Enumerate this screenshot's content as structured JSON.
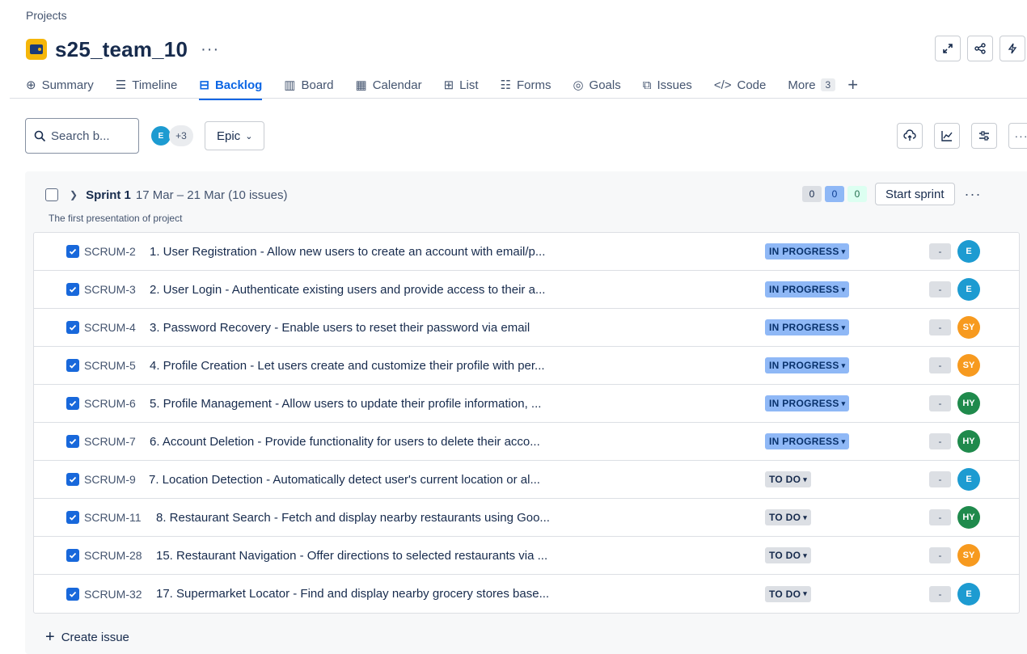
{
  "breadcrumb": "Projects",
  "project": {
    "name": "s25_team_10",
    "more": "···"
  },
  "tabs": [
    {
      "label": "Summary",
      "icon": "globe-icon",
      "glyph": "⊕",
      "active": false
    },
    {
      "label": "Timeline",
      "icon": "timeline-icon",
      "glyph": "☰",
      "active": false
    },
    {
      "label": "Backlog",
      "icon": "backlog-icon",
      "glyph": "⊟",
      "active": true
    },
    {
      "label": "Board",
      "icon": "board-icon",
      "glyph": "▥",
      "active": false
    },
    {
      "label": "Calendar",
      "icon": "calendar-icon",
      "glyph": "▦",
      "active": false
    },
    {
      "label": "List",
      "icon": "list-icon",
      "glyph": "⊞",
      "active": false
    },
    {
      "label": "Forms",
      "icon": "forms-icon",
      "glyph": "☷",
      "active": false
    },
    {
      "label": "Goals",
      "icon": "goals-icon",
      "glyph": "◎",
      "active": false
    },
    {
      "label": "Issues",
      "icon": "issues-icon",
      "glyph": "⧉",
      "active": false
    },
    {
      "label": "Code",
      "icon": "code-icon",
      "glyph": "</>",
      "active": false
    },
    {
      "label": "More",
      "icon": "",
      "glyph": "",
      "active": false,
      "count": "3"
    }
  ],
  "toolbar": {
    "search_placeholder": "Search b...",
    "avatar_initial": "E",
    "avatar_extra": "+3",
    "epic_label": "Epic"
  },
  "sprint": {
    "name": "Sprint 1",
    "dates": "17 Mar – 21 Mar (10 issues)",
    "description": "The first presentation of project",
    "counts": [
      "0",
      "0",
      "0"
    ],
    "start_label": "Start sprint",
    "more": "···"
  },
  "issues": [
    {
      "key": "SCRUM-2",
      "summary": "1. User Registration - Allow new users to create an account with email/p...",
      "status": "IN PROGRESS",
      "estimate": "-",
      "assignee": "E",
      "assignee_color": "#1d9bd1"
    },
    {
      "key": "SCRUM-3",
      "summary": "2. User Login - Authenticate existing users and provide access to their a...",
      "status": "IN PROGRESS",
      "estimate": "-",
      "assignee": "E",
      "assignee_color": "#1d9bd1"
    },
    {
      "key": "SCRUM-4",
      "summary": "3. Password Recovery - Enable users to reset their password via email",
      "status": "IN PROGRESS",
      "estimate": "-",
      "assignee": "SY",
      "assignee_color": "#f79a1f"
    },
    {
      "key": "SCRUM-5",
      "summary": "4. Profile Creation - Let users create and customize their profile with per...",
      "status": "IN PROGRESS",
      "estimate": "-",
      "assignee": "SY",
      "assignee_color": "#f79a1f"
    },
    {
      "key": "SCRUM-6",
      "summary": "5. Profile Management - Allow users to update their profile information, ...",
      "status": "IN PROGRESS",
      "estimate": "-",
      "assignee": "HY",
      "assignee_color": "#1f8a4c"
    },
    {
      "key": "SCRUM-7",
      "summary": "6. Account Deletion - Provide functionality for users to delete their acco...",
      "status": "IN PROGRESS",
      "estimate": "-",
      "assignee": "HY",
      "assignee_color": "#1f8a4c"
    },
    {
      "key": "SCRUM-9",
      "summary": "7. Location Detection - Automatically detect user's current location or al...",
      "status": "TO DO",
      "estimate": "-",
      "assignee": "E",
      "assignee_color": "#1d9bd1"
    },
    {
      "key": "SCRUM-11",
      "summary": "8. Restaurant Search - Fetch and display nearby restaurants using Goo...",
      "status": "TO DO",
      "estimate": "-",
      "assignee": "HY",
      "assignee_color": "#1f8a4c"
    },
    {
      "key": "SCRUM-28",
      "summary": "15. Restaurant Navigation - Offer directions to selected restaurants via ...",
      "status": "TO DO",
      "estimate": "-",
      "assignee": "SY",
      "assignee_color": "#f79a1f"
    },
    {
      "key": "SCRUM-32",
      "summary": "17. Supermarket Locator - Find and display nearby grocery stores base...",
      "status": "TO DO",
      "estimate": "-",
      "assignee": "E",
      "assignee_color": "#1d9bd1"
    }
  ],
  "create_issue_label": "Create issue",
  "colors": {
    "accent": "#0c66e4",
    "in_progress": "#8fb8f6",
    "todo": "#dcdfe4",
    "checkbox": "#1868db"
  }
}
